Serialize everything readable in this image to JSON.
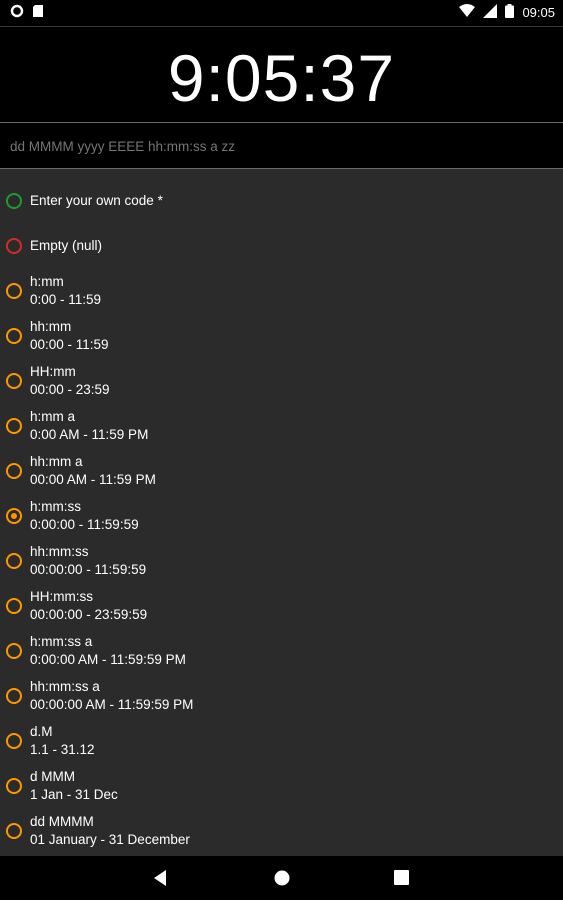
{
  "status_bar": {
    "left_icons": [
      "notification-circle-icon",
      "sd-card-icon"
    ],
    "right_icons": [
      "wifi-icon",
      "signal-icon",
      "battery-icon"
    ],
    "time": "09:05"
  },
  "clock": {
    "time": "9:05:37"
  },
  "format_field": {
    "placeholder": "dd MMMM yyyy EEEE hh:mm:ss a zz"
  },
  "colors": {
    "accent": "#ff9800",
    "custom_radio": "#1e9c2c",
    "null_radio": "#d42a2a",
    "list_bg": "#2b2b2b"
  },
  "options": [
    {
      "id": "custom",
      "title": "Enter your own code *",
      "subtitle": ""
    },
    {
      "id": "null",
      "title": "Empty (null)",
      "subtitle": ""
    },
    {
      "id": "h_mm",
      "title": "h:mm",
      "subtitle": "0:00 - 11:59"
    },
    {
      "id": "hh_mm",
      "title": "hh:mm",
      "subtitle": "00:00 - 11:59"
    },
    {
      "id": "HH_mm",
      "title": "HH:mm",
      "subtitle": "00:00 - 23:59"
    },
    {
      "id": "h_mm_a",
      "title": "h:mm a",
      "subtitle": "0:00 AM - 11:59 PM"
    },
    {
      "id": "hh_mm_a",
      "title": "hh:mm a",
      "subtitle": "00:00 AM - 11:59 PM"
    },
    {
      "id": "h_mm_ss",
      "title": "h:mm:ss",
      "subtitle": "0:00:00 - 11:59:59"
    },
    {
      "id": "hh_mm_ss",
      "title": "hh:mm:ss",
      "subtitle": "00:00:00 - 11:59:59"
    },
    {
      "id": "HH_mm_ss",
      "title": "HH:mm:ss",
      "subtitle": "00:00:00 - 23:59:59"
    },
    {
      "id": "h_mm_ss_a",
      "title": "h:mm:ss a",
      "subtitle": "0:00:00 AM - 11:59:59 PM"
    },
    {
      "id": "hh_mm_ss_a",
      "title": "hh:mm:ss a",
      "subtitle": "00:00:00 AM - 11:59:59 PM"
    },
    {
      "id": "d_M",
      "title": "d.M",
      "subtitle": "1.1 - 31.12"
    },
    {
      "id": "d_MMM",
      "title": "d MMM",
      "subtitle": "1 Jan - 31 Dec"
    },
    {
      "id": "dd_MMMM",
      "title": "dd MMMM",
      "subtitle": "01 January - 31 December"
    }
  ],
  "selected_option": "h_mm_ss",
  "nav_bar": {
    "buttons": [
      "back-icon",
      "home-icon",
      "recents-icon"
    ]
  }
}
